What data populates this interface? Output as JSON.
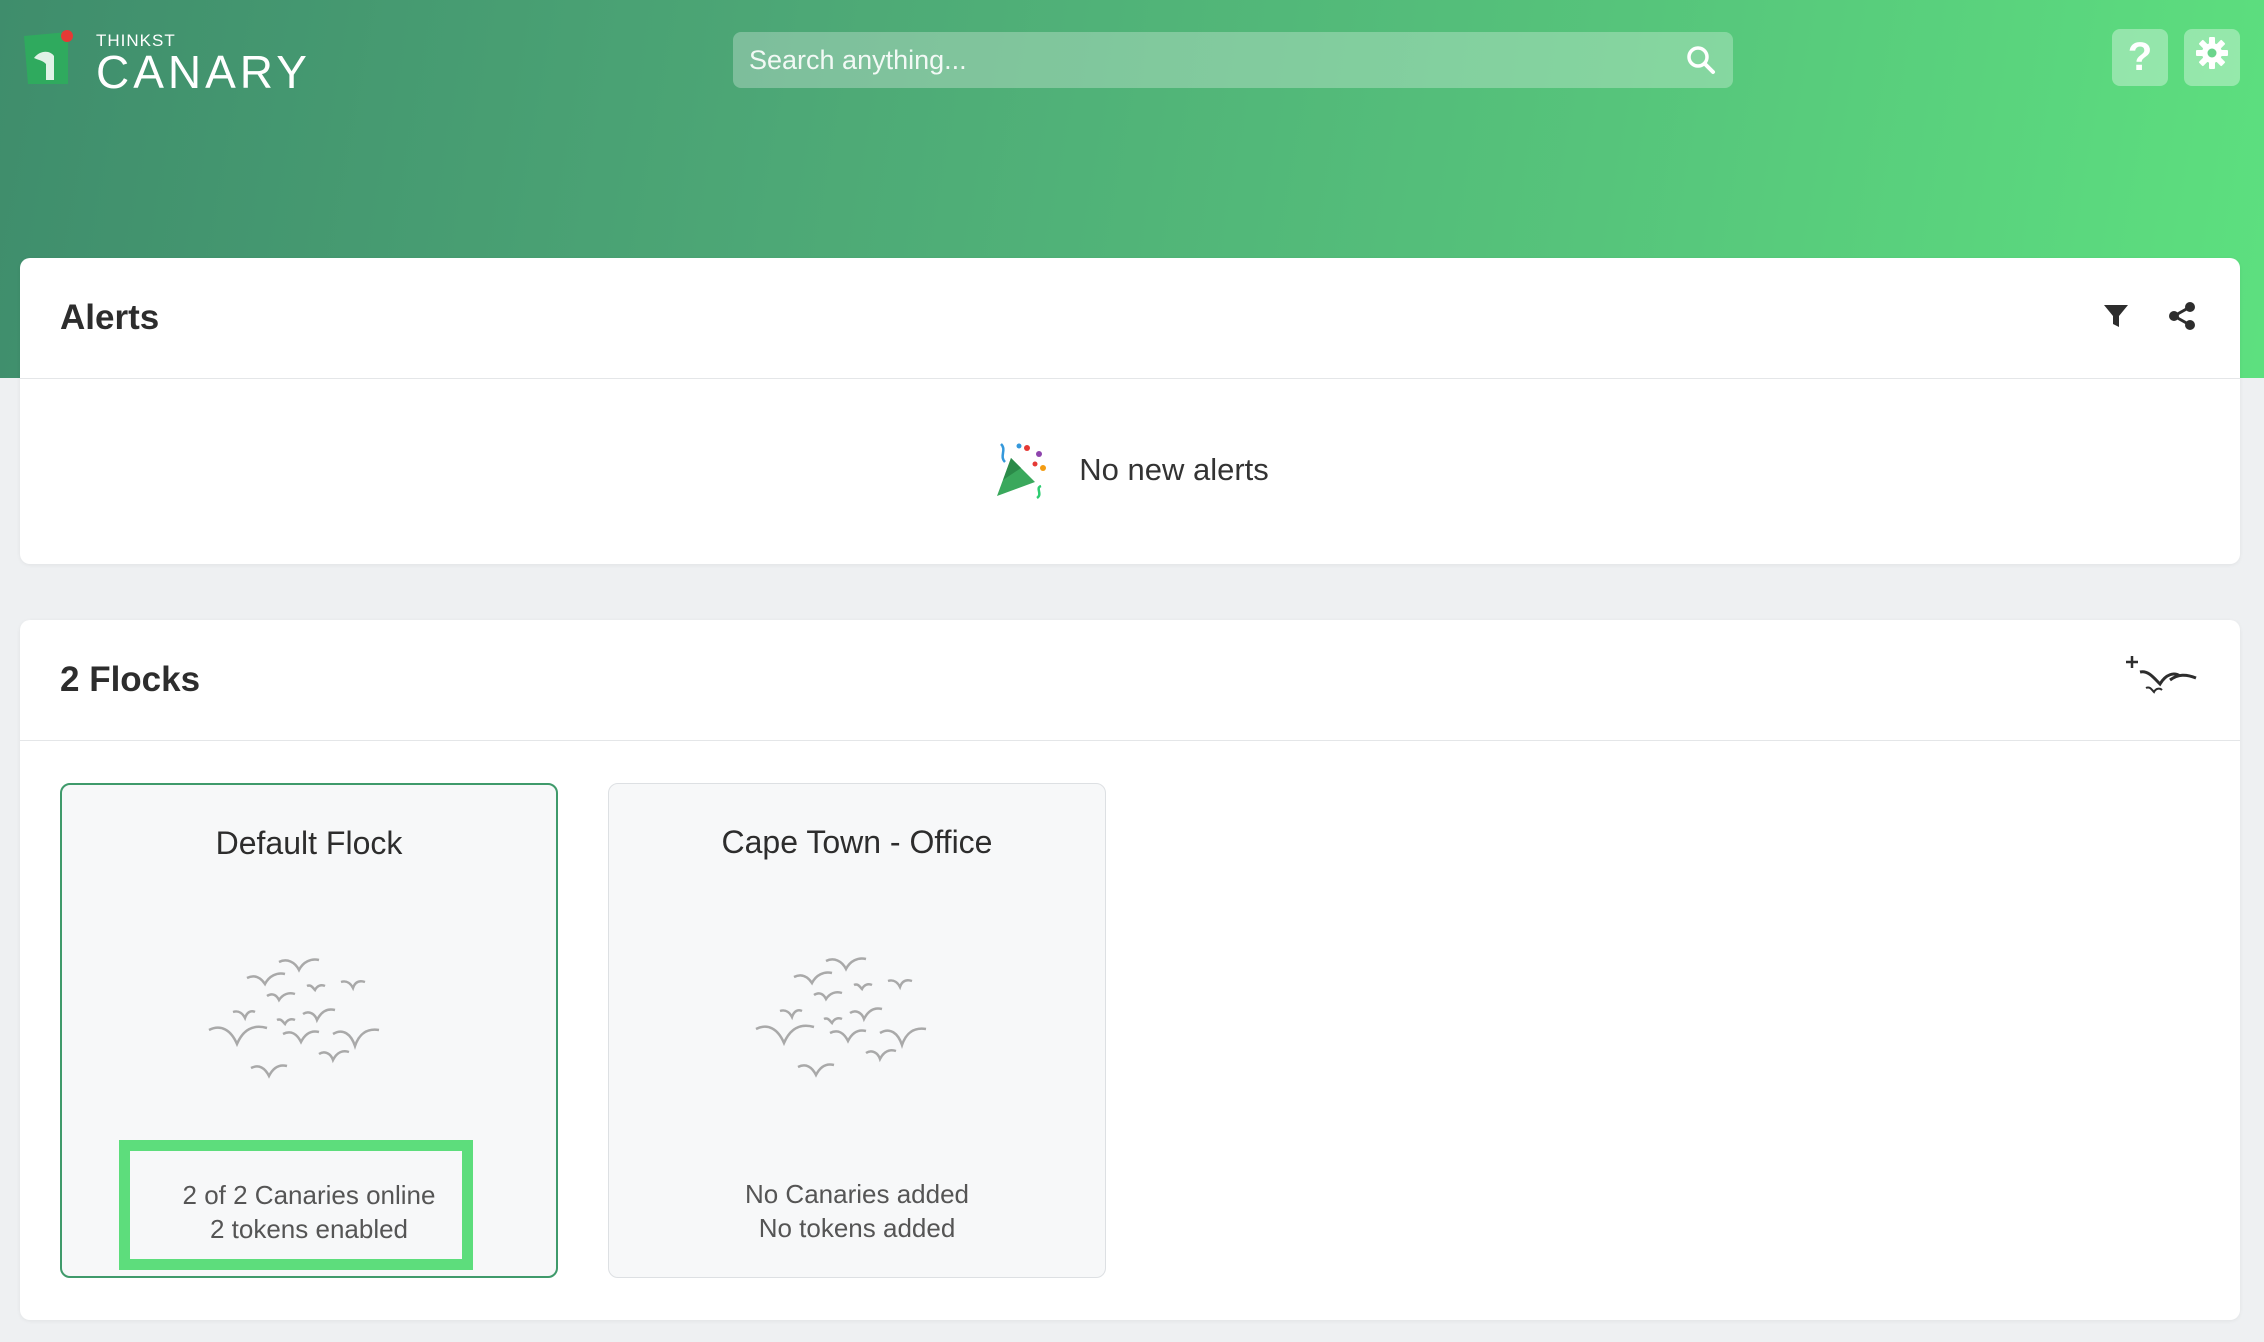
{
  "brand": {
    "small": "THINKST",
    "big": "CANARY",
    "accent": "#e53935"
  },
  "search": {
    "placeholder": "Search anything..."
  },
  "header": {
    "help_label": "?",
    "icons": [
      "search-icon",
      "help-icon",
      "gear-icon"
    ]
  },
  "alerts": {
    "title": "Alerts",
    "empty_text": "No new alerts",
    "icons": [
      "filter-icon",
      "share-icon",
      "party-popper-icon"
    ]
  },
  "flocks": {
    "title": "2 Flocks",
    "items": [
      {
        "name": "Default Flock",
        "status_line1": "2 of 2 Canaries online",
        "status_line2": "2 tokens enabled"
      },
      {
        "name": "Cape Town - Office",
        "status_line1": "No Canaries added",
        "status_line2": "No tokens added"
      }
    ]
  },
  "colors": {
    "header_start": "#3f8d6c",
    "header_end": "#5de07f",
    "active_border": "#3f9a6b",
    "highlight": "#5ddd7c"
  }
}
